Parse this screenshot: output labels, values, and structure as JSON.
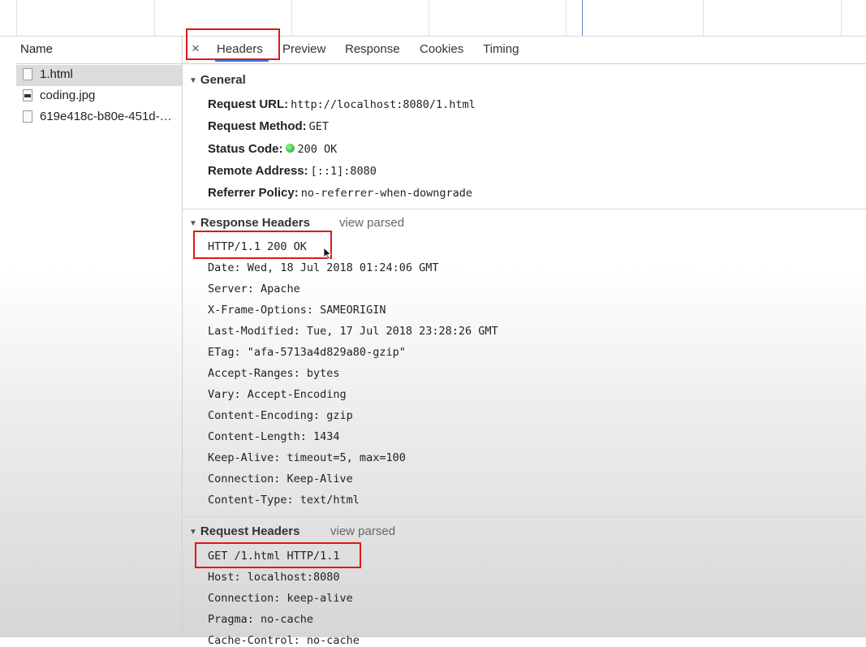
{
  "name_column": "Name",
  "files": [
    {
      "label": "1.html",
      "selected": true,
      "icon": "document-icon"
    },
    {
      "label": "coding.jpg",
      "selected": false,
      "icon": "image-file-icon"
    },
    {
      "label": "619e418c-b80e-451d-…",
      "selected": false,
      "icon": "document-icon"
    }
  ],
  "tabs": {
    "close": "×",
    "items": [
      "Headers",
      "Preview",
      "Response",
      "Cookies",
      "Timing"
    ],
    "active": "Headers"
  },
  "general": {
    "title": "General",
    "rows": [
      {
        "key": "Request URL:",
        "value": "http://localhost:8080/1.html"
      },
      {
        "key": "Request Method:",
        "value": "GET"
      },
      {
        "key": "Status Code:",
        "value": "200 OK"
      },
      {
        "key": "Remote Address:",
        "value": "[::1]:8080"
      },
      {
        "key": "Referrer Policy:",
        "value": "no-referrer-when-downgrade"
      }
    ]
  },
  "response_headers": {
    "title": "Response Headers",
    "view_parsed": "view parsed",
    "lines": [
      "HTTP/1.1 200 OK",
      "Date: Wed, 18 Jul 2018 01:24:06 GMT",
      "Server: Apache",
      "X-Frame-Options: SAMEORIGIN",
      "Last-Modified: Tue, 17 Jul 2018 23:28:26 GMT",
      "ETag: \"afa-5713a4d829a80-gzip\"",
      "Accept-Ranges: bytes",
      "Vary: Accept-Encoding",
      "Content-Encoding: gzip",
      "Content-Length: 1434",
      "Keep-Alive: timeout=5, max=100",
      "Connection: Keep-Alive",
      "Content-Type: text/html"
    ]
  },
  "request_headers": {
    "title": "Request Headers",
    "view_parsed": "view parsed",
    "lines": [
      "GET /1.html HTTP/1.1",
      "Host: localhost:8080",
      "Connection: keep-alive",
      "Pragma: no-cache",
      "Cache-Control: no-cache"
    ]
  },
  "colors": {
    "highlight_box": "#e01818",
    "status_ok": "#1aa31a",
    "active_tab_underline": "#3b78e7"
  }
}
